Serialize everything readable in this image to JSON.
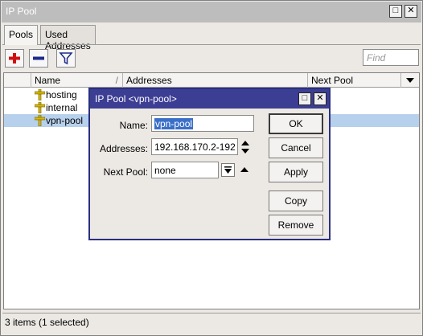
{
  "window": {
    "title": "IP Pool",
    "btn_max": "□",
    "btn_close": "✕"
  },
  "tabs": [
    {
      "label": "Pools"
    },
    {
      "label": "Used Addresses"
    }
  ],
  "toolbar": {
    "add_icon": "plus-icon",
    "remove_icon": "minus-icon",
    "filter_icon": "filter-icon",
    "find_placeholder": "Find"
  },
  "table": {
    "columns": [
      "Name",
      "Addresses",
      "Next Pool"
    ],
    "sort_marker": "/",
    "rows": [
      {
        "name": "hosting",
        "selected": false
      },
      {
        "name": "internal",
        "selected": false
      },
      {
        "name": "vpn-pool",
        "selected": true
      }
    ]
  },
  "status": "3 items (1 selected)",
  "dialog": {
    "title": "IP Pool <vpn-pool>",
    "btn_max": "□",
    "btn_close": "✕",
    "name_label": "Name:",
    "name_value": "vpn-pool",
    "addresses_label": "Addresses:",
    "addresses_value": "192.168.170.2-192",
    "next_pool_label": "Next Pool:",
    "next_pool_value": "none",
    "buttons": {
      "ok": "OK",
      "cancel": "Cancel",
      "apply": "Apply",
      "copy": "Copy",
      "remove": "Remove"
    }
  },
  "colors": {
    "dialog_title": "#3c3e94",
    "selection": "#b7d0ec",
    "add": "#d01010",
    "remove": "#1c2a8a",
    "pool_icon": "#d8b800"
  }
}
